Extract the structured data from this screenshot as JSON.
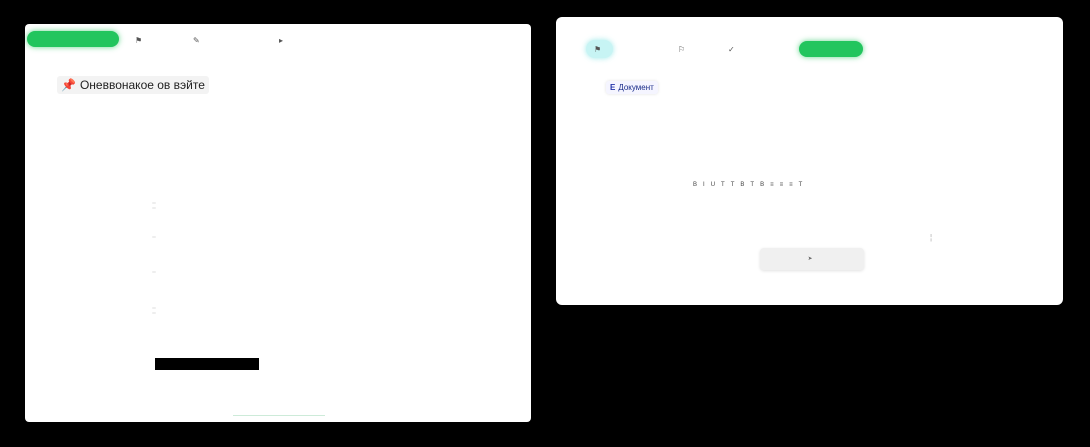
{
  "left": {
    "tabs": [
      {
        "label": "",
        "icon": "home-icon"
      },
      {
        "label": "",
        "icon": "user-icon"
      },
      {
        "label": "",
        "icon": "edit-icon"
      },
      {
        "label": "",
        "icon": "send-icon"
      }
    ],
    "page_title": "Оневвонакое ов вэйте",
    "sections": [
      {
        "title": "",
        "sub": ""
      },
      {
        "title": "",
        "sub": ""
      },
      {
        "title": "",
        "sub": ""
      },
      {
        "title": "",
        "sub": ""
      },
      {
        "title": "",
        "sub": ""
      },
      {
        "title": "",
        "sub": ""
      },
      {
        "title": "",
        "sub": ""
      }
    ],
    "bottom_link": ""
  },
  "right": {
    "tabs": [
      {
        "label": "",
        "icon": "user-icon"
      },
      {
        "label": "",
        "icon": "tag-icon"
      },
      {
        "label": "",
        "icon": "check-icon"
      },
      {
        "label": "",
        "icon": "send-icon"
      }
    ],
    "doc_badge": "Документ",
    "doc_badge_icon": "Е",
    "doc_sub": "",
    "form_label": "",
    "form_row_label": "",
    "toolbar": [
      "В",
      "I",
      "U",
      "T",
      "T",
      "B",
      "T",
      "B",
      "≡",
      "≡",
      "≡",
      "T"
    ],
    "submit_label": ""
  },
  "caption": ""
}
